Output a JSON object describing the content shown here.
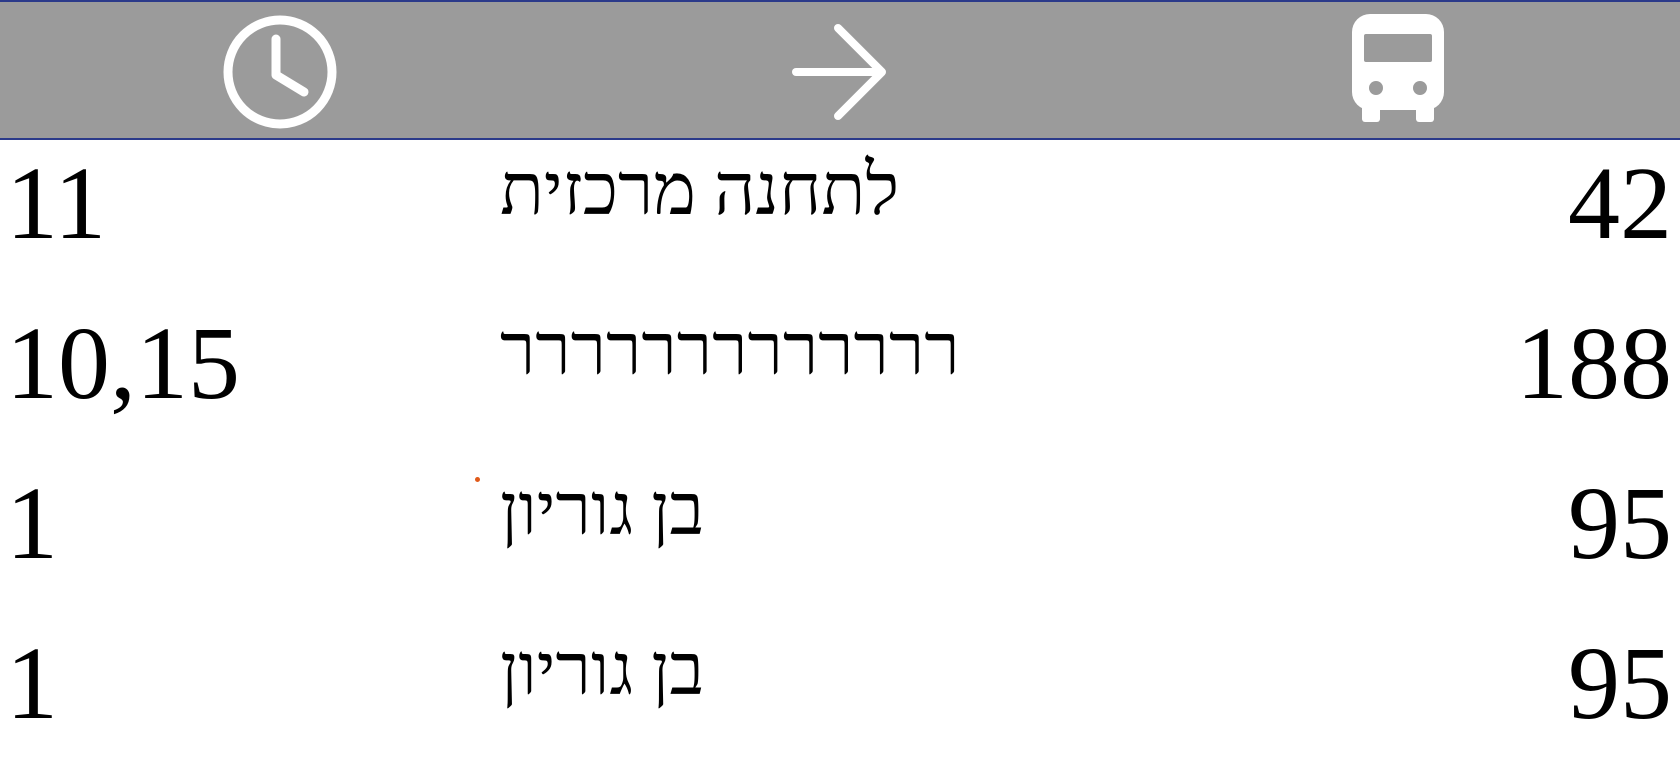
{
  "header": {
    "icons": [
      {
        "name": "clock-icon",
        "color": "#ffffff"
      },
      {
        "name": "arrow-right-icon",
        "color": "#ffffff"
      },
      {
        "name": "bus-icon",
        "color": "#ffffff"
      }
    ],
    "background": "#9b9b9b",
    "border_color": "#2b3a8a"
  },
  "rows": [
    {
      "minutes": "11",
      "destination": "לתחנה מרכזית",
      "line": "42"
    },
    {
      "minutes": "10,15",
      "destination": "ררררררררררררר",
      "line": "188"
    },
    {
      "minutes": "1",
      "destination": "בן גוריון",
      "line": "95"
    },
    {
      "minutes": "1",
      "destination": "בן גוריון",
      "line": "95"
    }
  ],
  "colors": {
    "text": "#000000",
    "icon": "#ffffff",
    "page_background": "#ffffff",
    "marker": "#e05a1a"
  }
}
